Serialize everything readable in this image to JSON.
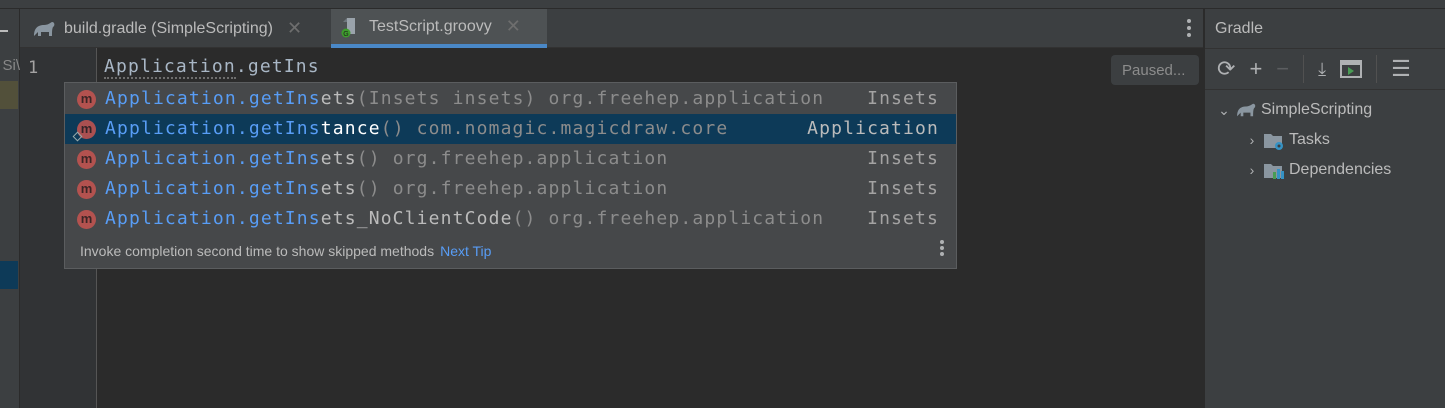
{
  "tabs": [
    {
      "label": "build.gradle (SimpleScripting)",
      "icon": "gradle-elephant-icon",
      "active": false
    },
    {
      "label": "TestScript.groovy",
      "icon": "groovy-file-icon",
      "active": true
    }
  ],
  "left_panel": {
    "fragment": "\\Si"
  },
  "editor": {
    "line_number": "1",
    "code_class": "Application",
    "code_rest": ".getIns",
    "status": "Paused..."
  },
  "completion": {
    "items": [
      {
        "match": "Application.getIns",
        "rest": "ets",
        "tail": "(Insets insets) org.freehep.application",
        "type": "Insets",
        "selected": false
      },
      {
        "match": "Application.getIns",
        "rest": "tance",
        "tail": "() com.nomagic.magicdraw.core",
        "type": "Application",
        "selected": true
      },
      {
        "match": "Application.getIns",
        "rest": "ets",
        "tail": "() org.freehep.application",
        "type": "Insets",
        "selected": false
      },
      {
        "match": "Application.getIns",
        "rest": "ets",
        "tail": "() org.freehep.application",
        "type": "Insets",
        "selected": false
      },
      {
        "match": "Application.getIns",
        "rest": "ets_NoClientCode",
        "tail": "() org.freehep.application",
        "type": "Insets",
        "selected": false
      }
    ],
    "method_badge": "m",
    "hint": "Invoke completion second time to show skipped methods",
    "next_tip": "Next Tip"
  },
  "gradle": {
    "title": "Gradle",
    "tree": [
      {
        "label": "SimpleScripting",
        "expanded": true,
        "level": 0
      },
      {
        "label": "Tasks",
        "expanded": false,
        "level": 1
      },
      {
        "label": "Dependencies",
        "expanded": false,
        "level": 1
      }
    ]
  },
  "colors": {
    "accent": "#4a88c7",
    "match": "#589df6",
    "selection": "#0d3a58"
  }
}
